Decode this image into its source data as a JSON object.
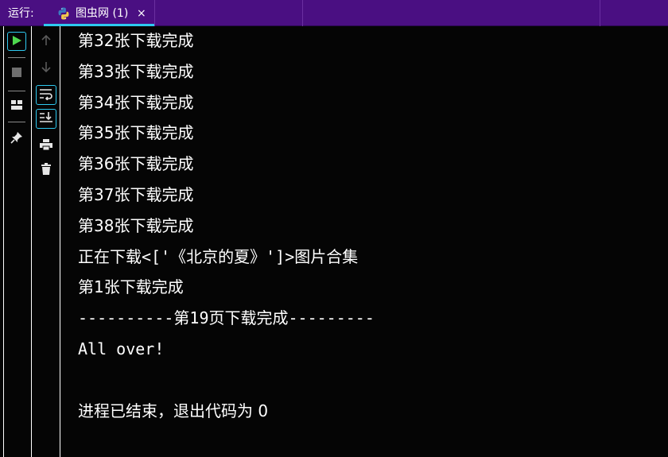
{
  "header": {
    "run_label": "运行:",
    "tab": {
      "title": "图虫网 (1)",
      "close": "×",
      "icon": "python-icon"
    },
    "accent_color": "#2ec9f0",
    "background_color": "#4a0f82"
  },
  "toolbar_left": {
    "buttons": [
      {
        "name": "run-button",
        "icon": "play-icon"
      },
      {
        "name": "stop-button",
        "icon": "stop-icon"
      },
      {
        "name": "layout-button",
        "icon": "layout-icon"
      },
      {
        "name": "pin-button",
        "icon": "pin-icon"
      }
    ]
  },
  "toolbar_mid": {
    "buttons": [
      {
        "name": "scroll-up-button",
        "icon": "arrow-up-icon"
      },
      {
        "name": "scroll-down-button",
        "icon": "arrow-down-icon"
      },
      {
        "name": "soft-wrap-button",
        "icon": "soft-wrap-icon"
      },
      {
        "name": "scroll-to-end-button",
        "icon": "scroll-to-end-icon"
      },
      {
        "name": "print-button",
        "icon": "print-icon"
      },
      {
        "name": "clear-button",
        "icon": "trash-icon"
      }
    ]
  },
  "console": {
    "lines": [
      "第32张下载完成",
      "第33张下载完成",
      "第34张下载完成",
      "第35张下载完成",
      "第36张下载完成",
      "第37张下载完成",
      "第38张下载完成",
      "正在下载<['《北京的夏》']>图片合集",
      "第1张下载完成",
      "----------第19页下载完成---------",
      "All over!",
      "",
      "进程已结束，退出代码为 0"
    ]
  }
}
